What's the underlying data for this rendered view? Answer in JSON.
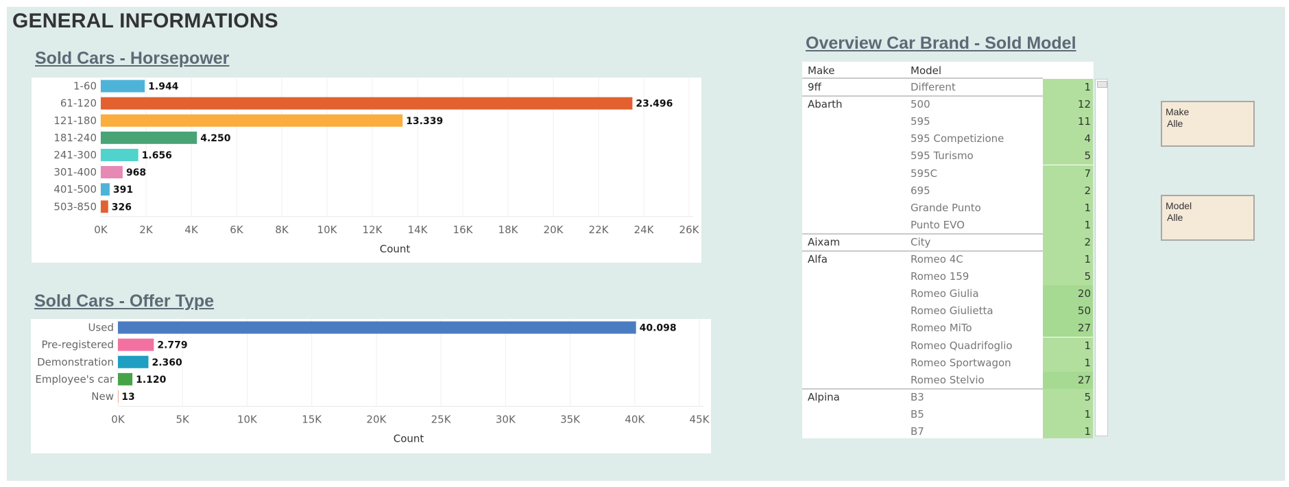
{
  "page": {
    "title": "GENERAL INFORMATIONS"
  },
  "chart_data": [
    {
      "type": "bar",
      "orientation": "horizontal",
      "title": "Sold Cars - Horsepower",
      "xlabel": "Count",
      "ylabel": "",
      "categories": [
        "1-60",
        "61-120",
        "121-180",
        "181-240",
        "241-300",
        "301-400",
        "401-500",
        "503-850"
      ],
      "values": [
        1944,
        23496,
        13339,
        4250,
        1656,
        968,
        391,
        326
      ],
      "value_labels": [
        "1.944",
        "23.496",
        "13.339",
        "4.250",
        "1.656",
        "968",
        "391",
        "326"
      ],
      "colors": [
        "#4eb3d9",
        "#e2612f",
        "#fbad3d",
        "#49a475",
        "#4fd3cc",
        "#e689b5",
        "#4eb3d9",
        "#e2612f"
      ],
      "ticks": [
        0,
        2000,
        4000,
        6000,
        8000,
        10000,
        12000,
        14000,
        16000,
        18000,
        20000,
        22000,
        24000,
        26000
      ],
      "tick_labels": [
        "0K",
        "2K",
        "4K",
        "6K",
        "8K",
        "10K",
        "12K",
        "14K",
        "16K",
        "18K",
        "20K",
        "22K",
        "24K",
        "26K"
      ],
      "xlim": [
        0,
        26000
      ],
      "grid": true
    },
    {
      "type": "bar",
      "orientation": "horizontal",
      "title": "Sold Cars - Offer Type",
      "xlabel": "Count",
      "ylabel": "",
      "categories": [
        "Used",
        "Pre-registered",
        "Demonstration",
        "Employee's car",
        "New"
      ],
      "values": [
        40098,
        2779,
        2360,
        1120,
        13
      ],
      "value_labels": [
        "40.098",
        "2.779",
        "2.360",
        "1.120",
        "13"
      ],
      "colors": [
        "#4a7cc1",
        "#f271a0",
        "#1f9fc1",
        "#47a348",
        "#e2612f"
      ],
      "ticks": [
        0,
        5000,
        10000,
        15000,
        20000,
        25000,
        30000,
        35000,
        40000,
        45000
      ],
      "tick_labels": [
        "0K",
        "5K",
        "10K",
        "15K",
        "20K",
        "25K",
        "30K",
        "35K",
        "40K",
        "45K"
      ],
      "xlim": [
        0,
        45000
      ],
      "grid": true
    }
  ],
  "table": {
    "title": "Overview Car Brand - Sold Model",
    "headers": {
      "make": "Make",
      "model": "Model"
    },
    "count_color": "#b2df9e",
    "groups": [
      {
        "make": "9ff",
        "rows": [
          {
            "model": "Different",
            "count": "1"
          }
        ]
      },
      {
        "make": "Abarth",
        "rows": [
          {
            "model": "500",
            "count": "12"
          },
          {
            "model": "595",
            "count": "11"
          },
          {
            "model": "595 Competizione",
            "count": "4"
          },
          {
            "model": "595 Turismo",
            "count": "5"
          },
          {
            "model": "595C",
            "count": "7"
          },
          {
            "model": "695",
            "count": "2"
          },
          {
            "model": "Grande Punto",
            "count": "1"
          },
          {
            "model": "Punto EVO",
            "count": "1"
          }
        ]
      },
      {
        "make": "Aixam",
        "rows": [
          {
            "model": "City",
            "count": "2"
          }
        ]
      },
      {
        "make": "Alfa",
        "rows": [
          {
            "model": "Romeo 4C",
            "count": "1"
          },
          {
            "model": "Romeo 159",
            "count": "5"
          },
          {
            "model": "Romeo Giulia",
            "count": "20"
          },
          {
            "model": "Romeo Giulietta",
            "count": "50"
          },
          {
            "model": "Romeo MiTo",
            "count": "27"
          },
          {
            "model": "Romeo Quadrifoglio",
            "count": "1"
          },
          {
            "model": "Romeo Sportwagon",
            "count": "1"
          },
          {
            "model": "Romeo Stelvio",
            "count": "27"
          }
        ]
      },
      {
        "make": "Alpina",
        "rows": [
          {
            "model": "B3",
            "count": "5"
          },
          {
            "model": "B5",
            "count": "1"
          },
          {
            "model": "B7",
            "count": "1"
          }
        ]
      }
    ]
  },
  "filters": [
    {
      "label": "Make",
      "value": "Alle"
    },
    {
      "label": "Model",
      "value": "Alle"
    }
  ]
}
